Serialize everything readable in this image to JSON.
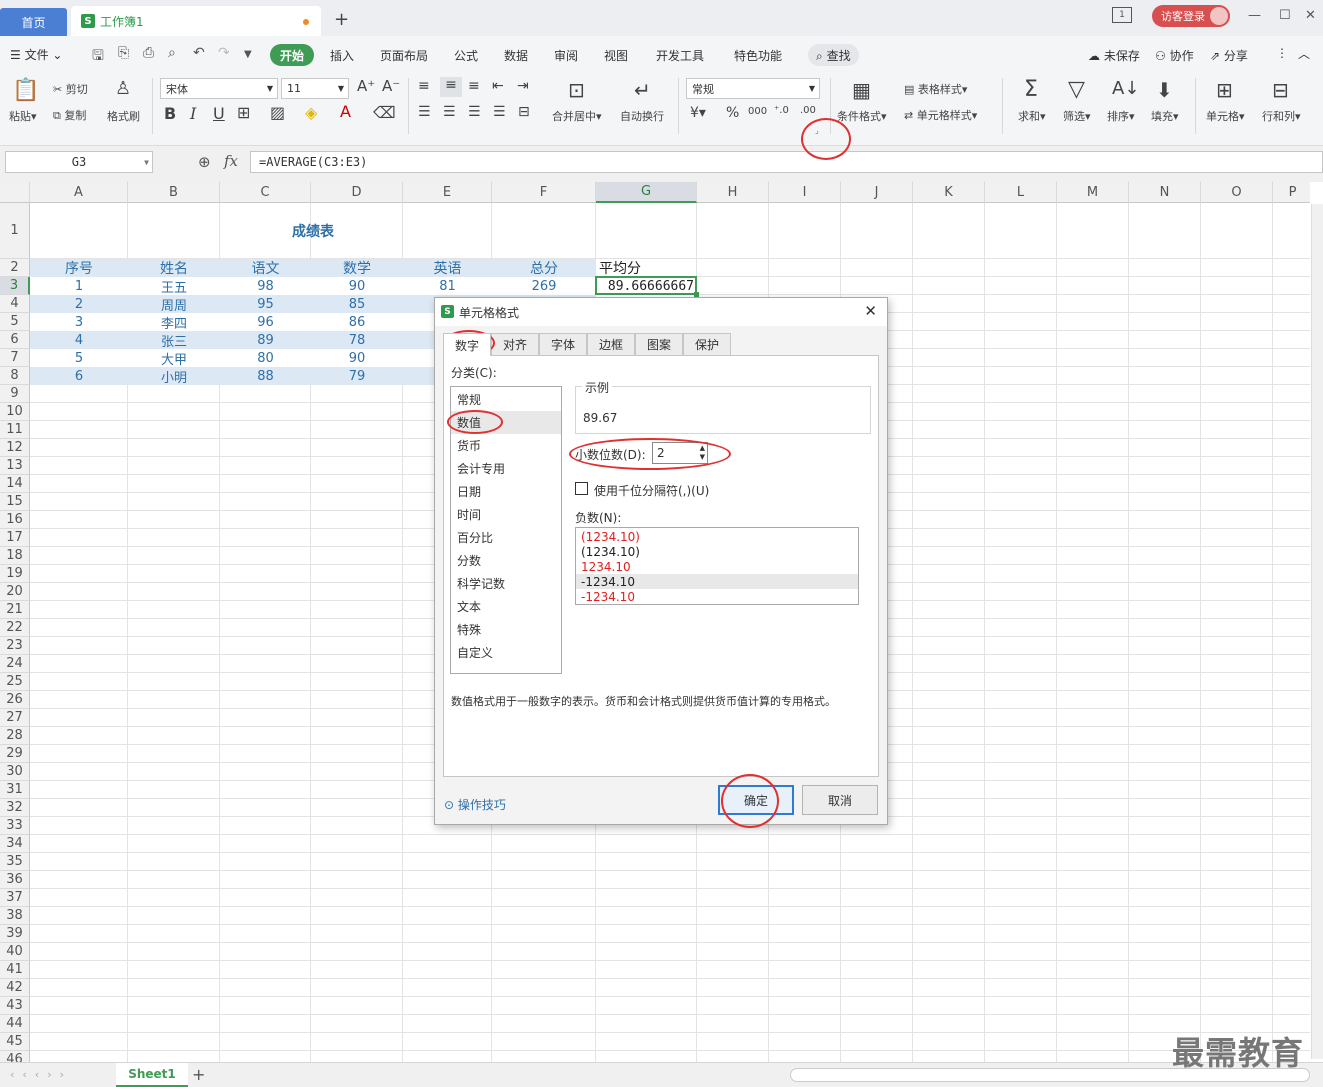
{
  "titlebar": {
    "home_tab": "首页",
    "doc_tab": "工作簿1",
    "login": "访客登录"
  },
  "menu": {
    "file": "文件",
    "items": [
      "开始",
      "插入",
      "页面布局",
      "公式",
      "数据",
      "审阅",
      "视图",
      "开发工具",
      "特色功能"
    ],
    "search": "查找",
    "unsaved": "未保存",
    "collab": "协作",
    "share": "分享"
  },
  "ribbon": {
    "paste": "粘贴",
    "cut": "剪切",
    "copy": "复制",
    "format_painter": "格式刷",
    "font_name": "宋体",
    "font_size": "11",
    "number_format": "常规",
    "merge": "合并居中",
    "wrap": "自动换行",
    "cond_format": "条件格式",
    "table_style": "表格样式",
    "cell_style": "单元格样式",
    "sum": "求和",
    "filter": "筛选",
    "sort": "排序",
    "fill": "填充",
    "cell": "单元格",
    "rowcol": "行和列"
  },
  "formula": {
    "cell_ref": "G3",
    "fx": "fx",
    "content": "=AVERAGE(C3:E3)"
  },
  "sheet": {
    "columns": [
      "A",
      "B",
      "C",
      "D",
      "E",
      "F",
      "G",
      "H",
      "I",
      "J",
      "K",
      "L",
      "M",
      "N",
      "O",
      "P"
    ],
    "title": "成绩表",
    "headers": [
      "序号",
      "姓名",
      "语文",
      "数学",
      "英语",
      "总分",
      "平均分"
    ],
    "rows": [
      [
        "1",
        "王五",
        "98",
        "90",
        "81",
        "269",
        "89.66666667"
      ],
      [
        "2",
        "周周",
        "95",
        "85",
        "",
        "",
        ""
      ],
      [
        "3",
        "李四",
        "96",
        "86",
        "",
        "",
        ""
      ],
      [
        "4",
        "张三",
        "89",
        "78",
        "",
        "",
        ""
      ],
      [
        "5",
        "大甲",
        "80",
        "90",
        "",
        "",
        ""
      ],
      [
        "6",
        "小明",
        "88",
        "79",
        "",
        "",
        ""
      ]
    ],
    "tab": "Sheet1"
  },
  "dialog": {
    "title": "单元格格式",
    "tabs": [
      "数字",
      "对齐",
      "字体",
      "边框",
      "图案",
      "保护"
    ],
    "category_label": "分类(C):",
    "categories": [
      "常规",
      "数值",
      "货币",
      "会计专用",
      "日期",
      "时间",
      "百分比",
      "分数",
      "科学记数",
      "文本",
      "特殊",
      "自定义"
    ],
    "selected_category": "数值",
    "sample_label": "示例",
    "sample_value": "89.67",
    "decimal_label": "小数位数(D):",
    "decimal_value": "2",
    "thousands_label": "使用千位分隔符(,)(U)",
    "negative_label": "负数(N):",
    "negatives": [
      "(1234.10)",
      "(1234.10)",
      "1234.10",
      "-1234.10",
      "-1234.10"
    ],
    "negative_colors": [
      "#e02020",
      "#222222",
      "#e02020",
      "#222222",
      "#e02020"
    ],
    "description": "数值格式用于一般数字的表示。货币和会计格式则提供货币值计算的专用格式。",
    "tips": "操作技巧",
    "ok": "确定",
    "cancel": "取消"
  },
  "watermark": "最需教育",
  "colors": {
    "accent_green": "#3f9b55",
    "header_fill": "#dce9f5",
    "data_blue": "#2f6fa8",
    "annotation_red": "#e03030"
  }
}
